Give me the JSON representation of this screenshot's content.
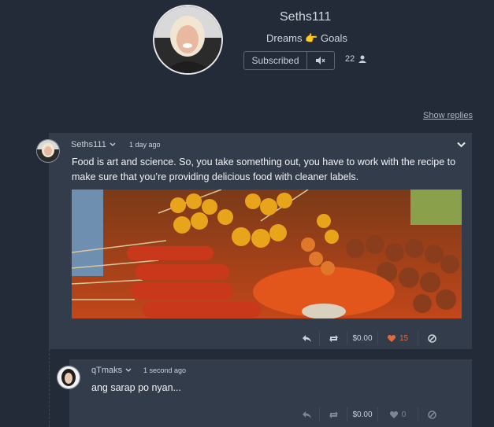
{
  "profile": {
    "username": "Seths111",
    "bio_left": "Dreams",
    "bio_emoji": "👉",
    "bio_right": "Goals",
    "subscribe_label": "Subscribed",
    "subscriber_count": "22"
  },
  "show_replies_label": "Show replies",
  "comments": [
    {
      "author": "Seths111",
      "time": "1 day ago",
      "text": "Food is art and science. So, you take something out, you have to work with the recipe to make sure that you’re providing delicious food with cleaner labels.",
      "tip": "$0.00",
      "likes": "15",
      "liked": true
    },
    {
      "author": "qTmaks",
      "time": "1 second ago",
      "text": "ang sarap po nyan...",
      "tip": "$0.00",
      "likes": "0",
      "liked": false
    }
  ],
  "colors": {
    "background": "#232b38",
    "card": "#333c4a",
    "like_active": "#e06a3c"
  }
}
